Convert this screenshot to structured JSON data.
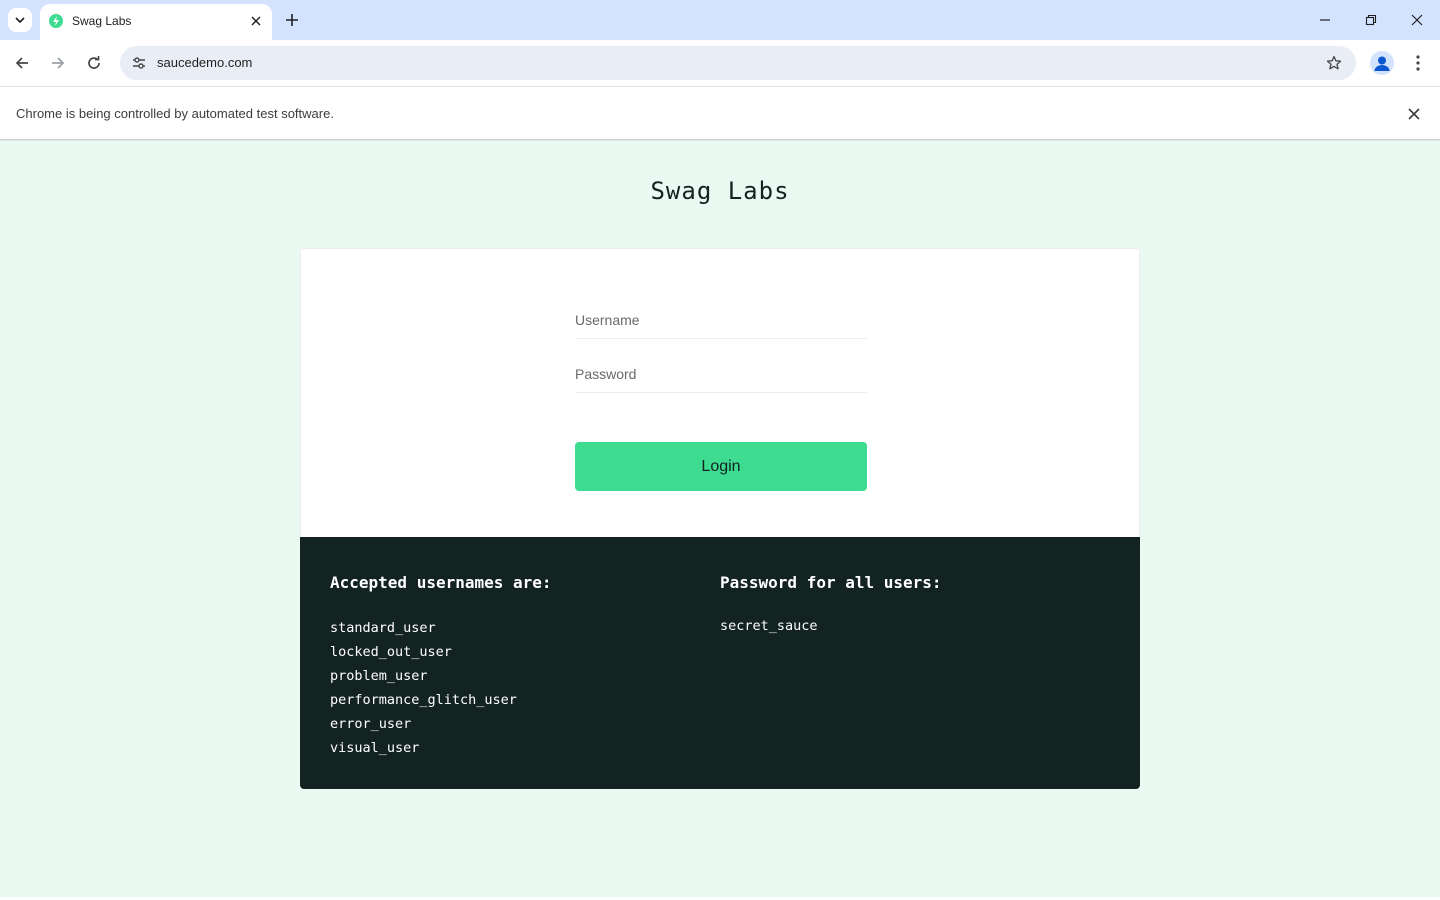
{
  "browser": {
    "tab_title": "Swag Labs",
    "url": "saucedemo.com",
    "infobar_text": "Chrome is being controlled by automated test software."
  },
  "page": {
    "logo": "Swag Labs",
    "username_placeholder": "Username",
    "password_placeholder": "Password",
    "login_label": "Login",
    "usernames_title": "Accepted usernames are:",
    "usernames": [
      "standard_user",
      "locked_out_user",
      "problem_user",
      "performance_glitch_user",
      "error_user",
      "visual_user"
    ],
    "password_title": "Password for all users:",
    "password": "secret_sauce"
  },
  "colors": {
    "accent": "#3ddc91",
    "dark": "#132322",
    "background": "#eaf9f1"
  }
}
